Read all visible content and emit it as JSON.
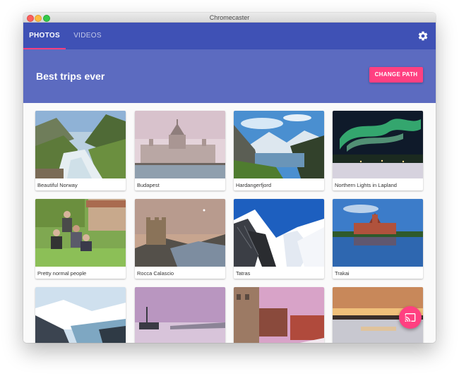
{
  "window": {
    "title": "Chromecaster"
  },
  "tabs": [
    {
      "label": "PHOTOS",
      "active": true
    },
    {
      "label": "VIDEOS",
      "active": false
    }
  ],
  "header": {
    "title": "Best trips ever",
    "button_label": "CHANGE PATH"
  },
  "photos": [
    {
      "caption": "Beautiful Norway"
    },
    {
      "caption": "Budapest"
    },
    {
      "caption": "Hardangerfjord"
    },
    {
      "caption": "Northern Lights in Lapland"
    },
    {
      "caption": "Pretty normal people"
    },
    {
      "caption": "Rocca Calascio"
    },
    {
      "caption": "Tatras"
    },
    {
      "caption": "Trakai"
    },
    {
      "caption": ""
    },
    {
      "caption": ""
    },
    {
      "caption": ""
    },
    {
      "caption": ""
    }
  ],
  "icons": {
    "settings": "gear-icon",
    "cast": "cast-icon"
  },
  "colors": {
    "primary": "#3f51b5",
    "header": "#5c6bc0",
    "accent": "#ff4081"
  }
}
